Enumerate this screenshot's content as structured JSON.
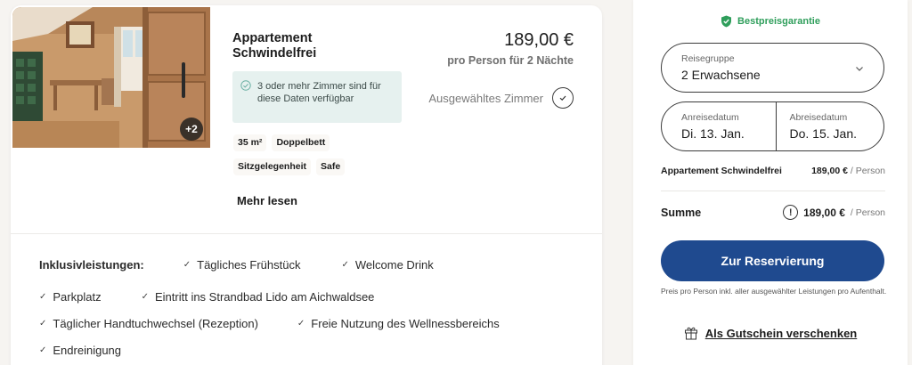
{
  "room": {
    "title": "Appartement Schwindelfrei",
    "photo_count_badge": "+2",
    "availability_text": "3 oder mehr Zimmer sind für diese Daten verfügbar",
    "tags": [
      "35 m²",
      "Doppelbett",
      "Sitzgelegenheit",
      "Safe"
    ],
    "read_more": "Mehr lesen",
    "price": "189,00 €",
    "price_subtitle": "pro Person für 2 Nächte",
    "selected_label": "Ausgewähltes Zimmer"
  },
  "inclusions": {
    "heading": "Inklusivleistungen:",
    "items": [
      "Tägliches Frühstück",
      "Welcome Drink",
      "Parkplatz",
      "Eintritt ins Strandbad Lido am Aichwaldsee",
      "Täglicher Handtuchwechsel (Rezeption)",
      "Freie Nutzung des Wellnessbereichs",
      "Endreinigung"
    ]
  },
  "booking": {
    "guarantee": "Bestpreisgarantie",
    "guests_label": "Reisegruppe",
    "guests_value": "2 Erwachsene",
    "arrival_label": "Anreisedatum",
    "arrival_value": "Di. 13. Jan.",
    "departure_label": "Abreisedatum",
    "departure_value": "Do. 15. Jan.",
    "line_item_name": "Appartement Schwindelfrei",
    "line_item_price": "189,00 €",
    "per_person": "/ Person",
    "total_label": "Summe",
    "total_price": "189,00 €",
    "info_symbol": "!",
    "reserve_button": "Zur Reservierung",
    "price_note": "Preis pro Person inkl. aller ausgewählter Leistungen pro Aufenthalt.",
    "voucher_link": "Als Gutschein verschenken"
  },
  "colors": {
    "accent_blue": "#1f4a8f",
    "guarantee_green": "#2f9e5b",
    "availability_bg": "#e6f1ef"
  },
  "icons": {
    "selected": "check-circle-icon",
    "guarantee": "shield-check-icon",
    "gift": "gift-icon",
    "info": "info-icon"
  }
}
